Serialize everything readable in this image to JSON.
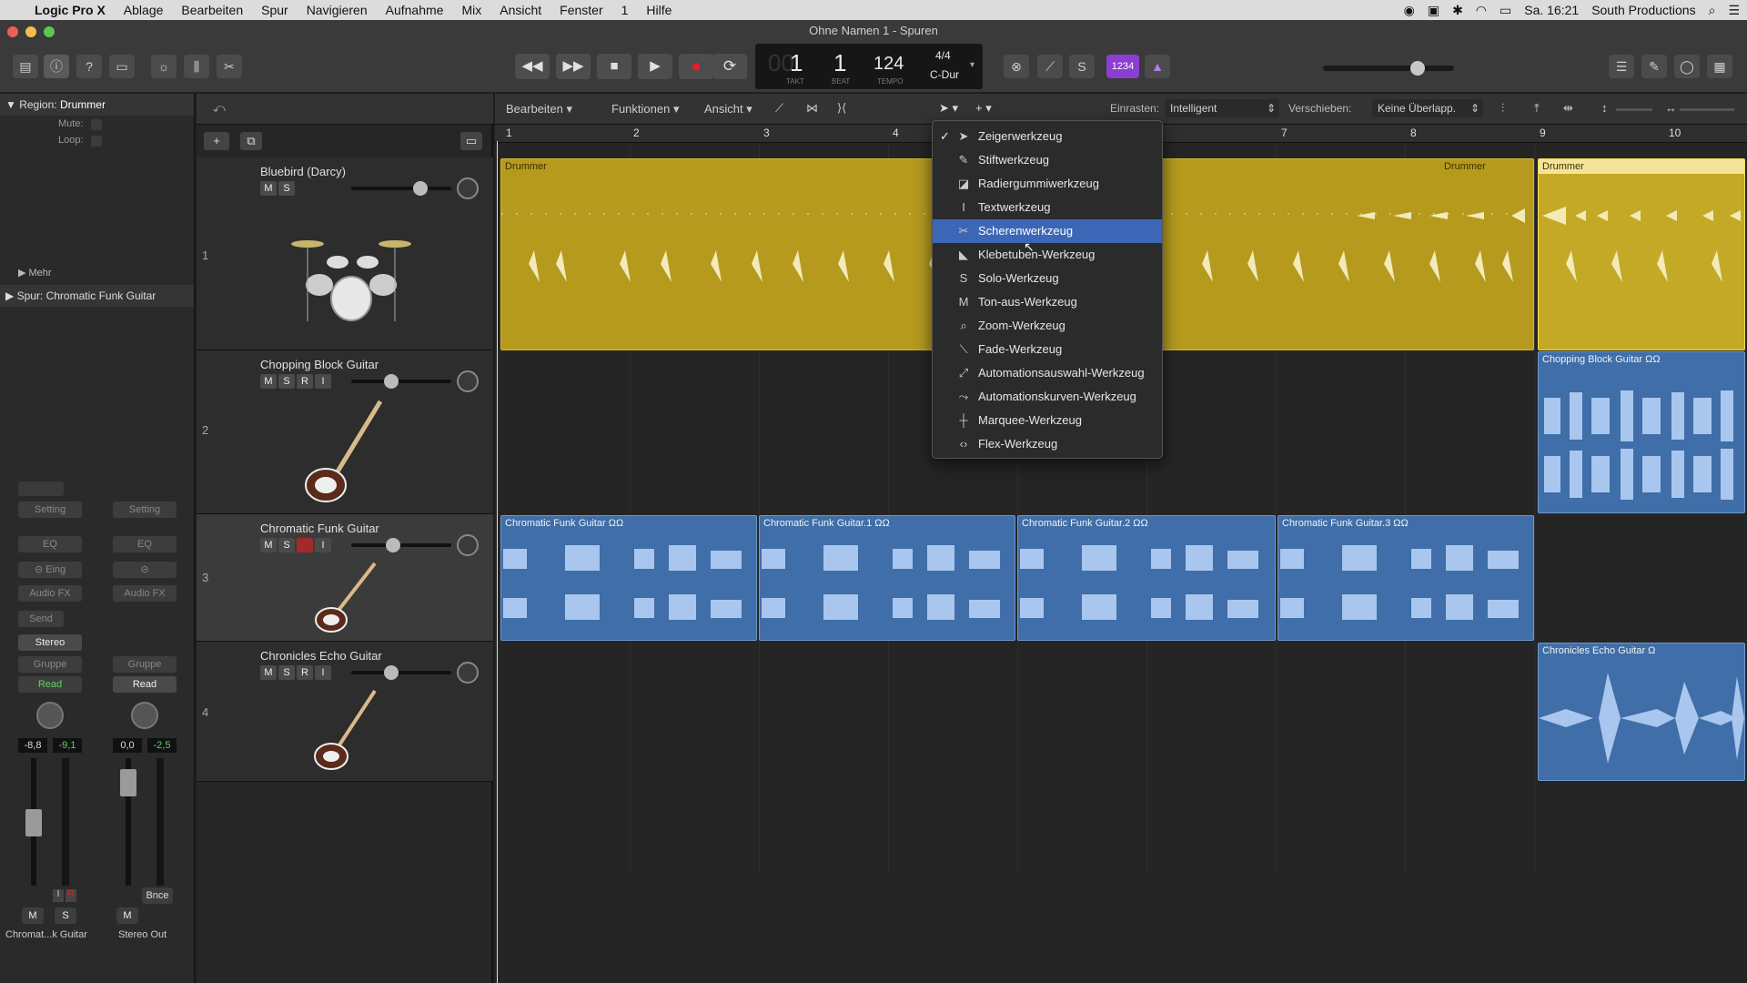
{
  "menubar": {
    "app": "Logic Pro X",
    "items": [
      "Ablage",
      "Bearbeiten",
      "Spur",
      "Navigieren",
      "Aufnahme",
      "Mix",
      "Ansicht",
      "Fenster",
      "1",
      "Hilfe"
    ],
    "datetime": "Sa. 16:21",
    "user": "South Productions"
  },
  "window": {
    "title": "Ohne Namen 1 - Spuren"
  },
  "transport": {
    "bar": "1",
    "beat": "1",
    "tempo": "124",
    "signature": "4/4",
    "key": "C-Dur",
    "bar_label": "TAKT",
    "beat_label": "BEAT",
    "tempo_label": "TEMPO",
    "count_in": "1234"
  },
  "inspector": {
    "region_label": "Region:",
    "region_name": "Drummer",
    "mute_label": "Mute:",
    "loop_label": "Loop:",
    "more_label": "Mehr",
    "track_label": "Spur: Chromatic Funk Guitar",
    "strip1": {
      "setting": "Setting",
      "eq": "EQ",
      "input": "Eing",
      "audio_fx": "Audio FX",
      "send": "Send",
      "output": "Stereo",
      "group": "Gruppe",
      "automation": "Read",
      "vol": "-8,8",
      "peak": "-9,1",
      "m": "M",
      "s": "S",
      "name": "Chromat...k Guitar"
    },
    "strip2": {
      "setting": "Setting",
      "eq": "EQ",
      "audio_fx": "Audio FX",
      "group": "Gruppe",
      "automation": "Read",
      "vol": "0,0",
      "peak": "-2,5",
      "bounce": "Bnce",
      "m": "M",
      "name": "Stereo Out"
    }
  },
  "arrange_bar": {
    "edit": "Bearbeiten",
    "functions": "Funktionen",
    "view": "Ansicht",
    "snap_label": "Einrasten:",
    "snap_value": "Intelligent",
    "drag_label": "Verschieben:",
    "drag_value": "Keine Überlapp."
  },
  "ruler": [
    "1",
    "2",
    "3",
    "4",
    "7",
    "8",
    "9",
    "10"
  ],
  "tracks": [
    {
      "num": "1",
      "name": "Bluebird (Darcy)",
      "buttons": [
        "M",
        "S"
      ]
    },
    {
      "num": "2",
      "name": "Chopping Block Guitar",
      "buttons": [
        "M",
        "S",
        "R",
        "I"
      ]
    },
    {
      "num": "3",
      "name": "Chromatic Funk Guitar",
      "buttons": [
        "M",
        "S",
        "R",
        "I"
      ]
    },
    {
      "num": "4",
      "name": "Chronicles Echo Guitar",
      "buttons": [
        "M",
        "S",
        "R",
        "I"
      ]
    }
  ],
  "regions": {
    "drummer1": "Drummer",
    "drummer2": "Drummer",
    "drummer3": "Drummer",
    "chop": "Chopping Block Guitar",
    "cfg1": "Chromatic Funk Guitar",
    "cfg2": "Chromatic Funk Guitar.1",
    "cfg3": "Chromatic Funk Guitar.2",
    "cfg4": "Chromatic Funk Guitar.3",
    "echo": "Chronicles Echo Guitar"
  },
  "tool_menu": [
    {
      "label": "Zeigerwerkzeug",
      "icon": "pointer-icon",
      "checked": true
    },
    {
      "label": "Stiftwerkzeug",
      "icon": "pencil-icon"
    },
    {
      "label": "Radiergummiwerkzeug",
      "icon": "eraser-icon"
    },
    {
      "label": "Textwerkzeug",
      "icon": "text-icon"
    },
    {
      "label": "Scherenwerkzeug",
      "icon": "scissors-icon",
      "highlighted": true
    },
    {
      "label": "Klebetuben-Werkzeug",
      "icon": "glue-icon"
    },
    {
      "label": "Solo-Werkzeug",
      "icon": "solo-icon"
    },
    {
      "label": "Ton-aus-Werkzeug",
      "icon": "mute-icon"
    },
    {
      "label": "Zoom-Werkzeug",
      "icon": "zoom-icon"
    },
    {
      "label": "Fade-Werkzeug",
      "icon": "fade-icon"
    },
    {
      "label": "Automationsauswahl-Werkzeug",
      "icon": "automation-select-icon"
    },
    {
      "label": "Automationskurven-Werkzeug",
      "icon": "automation-curve-icon"
    },
    {
      "label": "Marquee-Werkzeug",
      "icon": "marquee-icon"
    },
    {
      "label": "Flex-Werkzeug",
      "icon": "flex-icon"
    }
  ],
  "colors": {
    "drummer": "#b59a1e",
    "audio": "#3f6ea8",
    "highlight": "#3b67b6",
    "read": "#5fd35f",
    "record": "#e0202a"
  }
}
